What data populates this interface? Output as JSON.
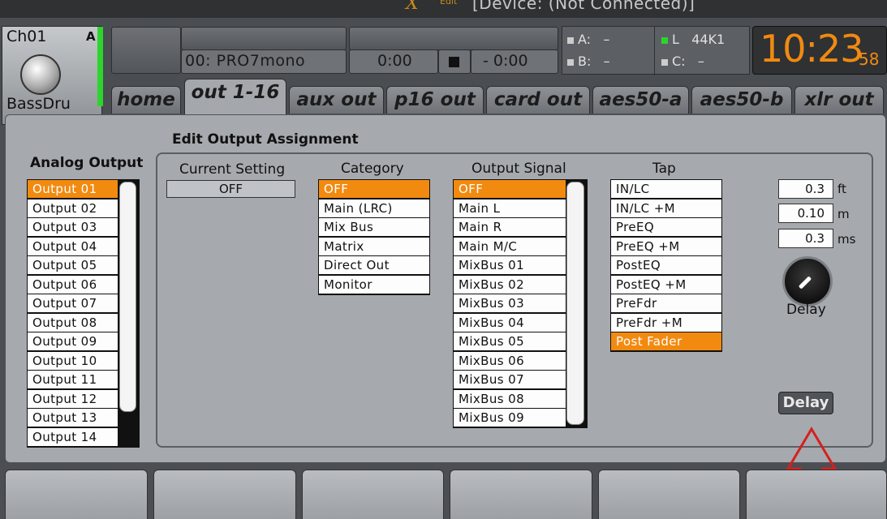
{
  "title_bar": {
    "logo": "X",
    "logo_sub": "Edit",
    "device_status": "[Device: (Not Connected)]"
  },
  "channel": {
    "name": "Ch01",
    "badge": "A",
    "label": "BassDru",
    "icon": "bass-drum-icon",
    "meter_color": "#2dd42d"
  },
  "scene": {
    "name": "00: PRO7mono",
    "time_elapsed": "0:00",
    "time_remaining": "- 0:00"
  },
  "status": {
    "a_label": "A:",
    "a_value": "–",
    "b_label": "B:",
    "b_value": "–",
    "l_label": "L",
    "l_rate": "44K1",
    "c_label": "C:",
    "c_value": "–"
  },
  "clock": {
    "hm": "10:23",
    "sec": "58"
  },
  "tabs": [
    {
      "label": "home",
      "active": false
    },
    {
      "label": "out 1-16",
      "active": true
    },
    {
      "label": "aux out",
      "active": false
    },
    {
      "label": "p16 out",
      "active": false
    },
    {
      "label": "card out",
      "active": false
    },
    {
      "label": "aes50-a",
      "active": false
    },
    {
      "label": "aes50-b",
      "active": false
    },
    {
      "label": "xlr out",
      "active": false
    }
  ],
  "analog_output": {
    "title": "Analog Output",
    "items": [
      "Output 01",
      "Output 02",
      "Output 03",
      "Output 04",
      "Output 05",
      "Output 06",
      "Output 07",
      "Output 08",
      "Output 09",
      "Output 10",
      "Output 11",
      "Output 12",
      "Output 13",
      "Output 14"
    ],
    "selected": 0
  },
  "edit": {
    "title": "Edit Output Assignment",
    "current_setting_label": "Current Setting",
    "current_setting_value": "OFF",
    "category_label": "Category",
    "category_items": [
      "OFF",
      "Main (LRC)",
      "Mix Bus",
      "Matrix",
      "Direct Out",
      "Monitor"
    ],
    "category_selected": 0,
    "signal_label": "Output Signal",
    "signal_items": [
      "OFF",
      "Main L",
      "Main R",
      "Main M/C",
      "MixBus 01",
      "MixBus 02",
      "MixBus 03",
      "MixBus 04",
      "MixBus 05",
      "MixBus 06",
      "MixBus 07",
      "MixBus 08",
      "MixBus 09"
    ],
    "signal_selected": 0,
    "tap_label": "Tap",
    "tap_items": [
      "IN/LC",
      "IN/LC +M",
      "PreEQ",
      "PreEQ +M",
      "PostEQ",
      "PostEQ +M",
      "PreFdr",
      "PreFdr +M",
      "Post Fader"
    ],
    "tap_selected": 8
  },
  "delay": {
    "ft_value": "0.3",
    "ft_unit": "ft",
    "m_value": "0.10",
    "m_unit": "m",
    "ms_value": "0.3",
    "ms_unit": "ms",
    "knob_label": "Delay",
    "button_label": "Delay"
  },
  "colors": {
    "accent": "#f28a10",
    "annotation_arrow": "#d42020"
  }
}
